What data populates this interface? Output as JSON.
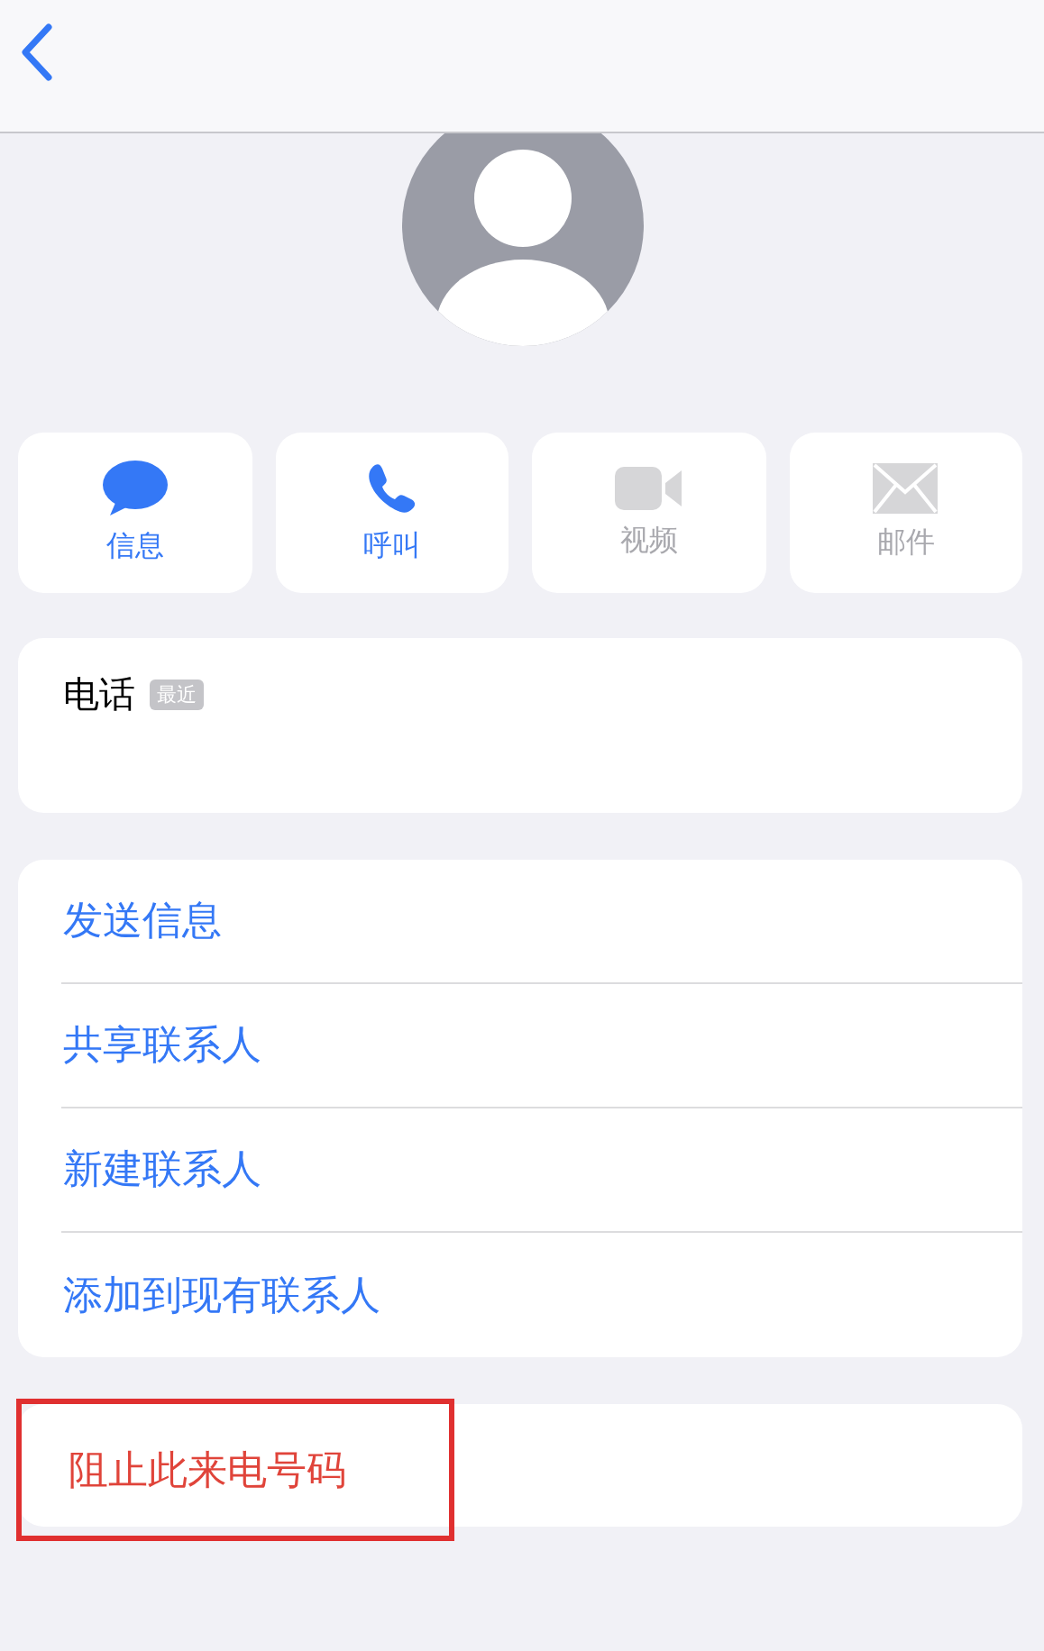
{
  "actions": [
    {
      "kind": "message",
      "label": "信息",
      "disabled": false
    },
    {
      "kind": "call",
      "label": "呼叫",
      "disabled": false
    },
    {
      "kind": "video",
      "label": "视频",
      "disabled": true
    },
    {
      "kind": "mail",
      "label": "邮件",
      "disabled": true
    }
  ],
  "phone": {
    "label": "电话",
    "badge": "最近"
  },
  "menu": [
    "发送信息",
    "共享联系人",
    "新建联系人",
    "添加到现有联系人"
  ],
  "block": {
    "label": "阻止此来电号码",
    "highlighted": true
  }
}
